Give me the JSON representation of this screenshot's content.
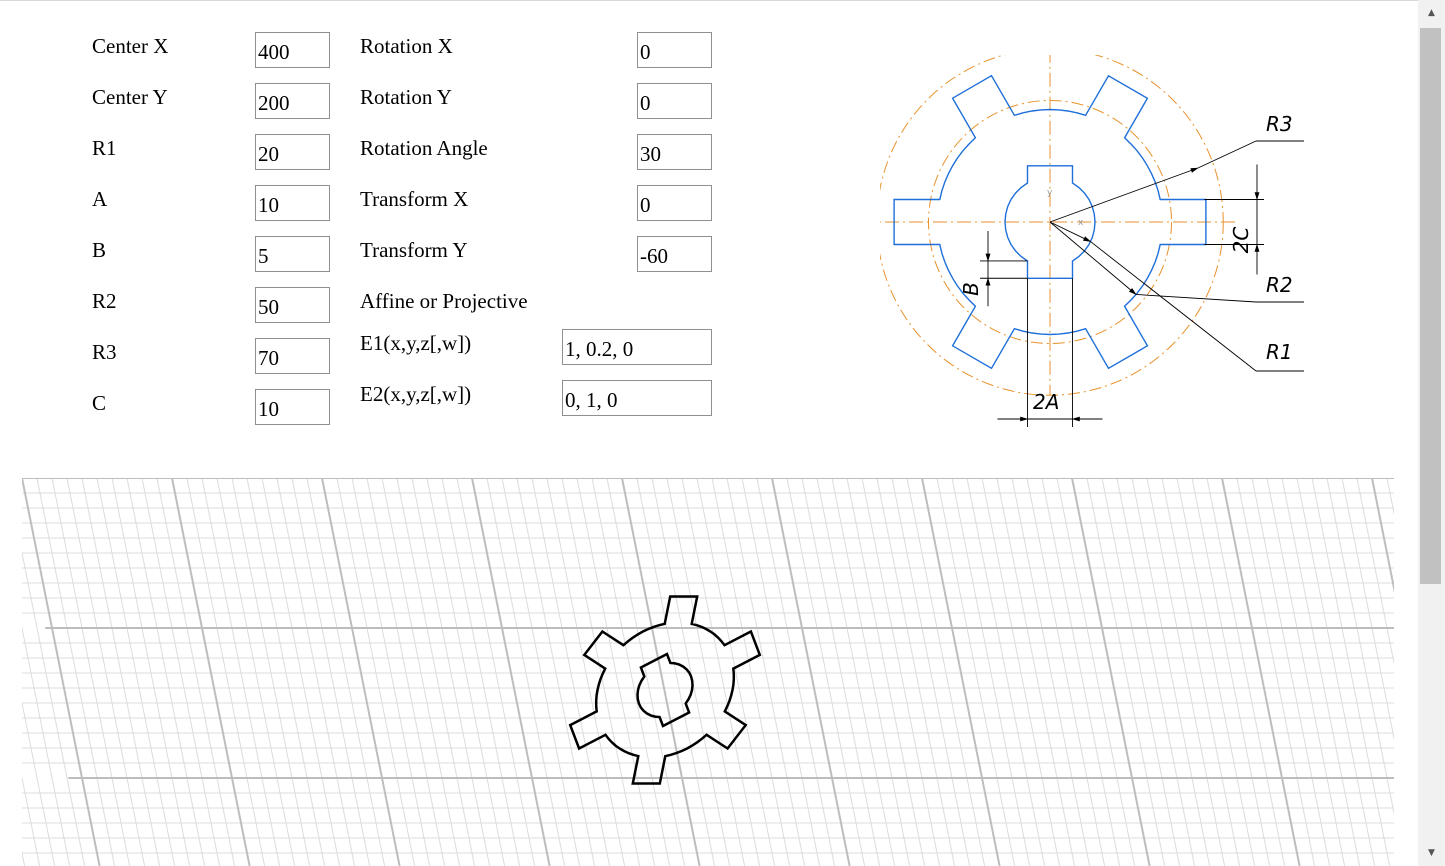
{
  "form": {
    "center_x": {
      "label": "Center X",
      "value": "400"
    },
    "center_y": {
      "label": "Center Y",
      "value": "200"
    },
    "r1": {
      "label": "R1",
      "value": "20"
    },
    "a": {
      "label": "A",
      "value": "10"
    },
    "b": {
      "label": "B",
      "value": "5"
    },
    "r2": {
      "label": "R2",
      "value": "50"
    },
    "r3": {
      "label": "R3",
      "value": "70"
    },
    "c": {
      "label": "C",
      "value": "10"
    },
    "rotation_x": {
      "label": "Rotation X",
      "value": "0"
    },
    "rotation_y": {
      "label": "Rotation Y",
      "value": "0"
    },
    "rotation_angle": {
      "label": "Rotation Angle",
      "value": "30"
    },
    "transform_x": {
      "label": "Transform X",
      "value": "0"
    },
    "transform_y": {
      "label": "Transform Y",
      "value": "-60"
    },
    "affine_label": "Affine or Projective",
    "e1": {
      "label": "E1(x,y,z[,w])",
      "value": "1, 0.2, 0"
    },
    "e2": {
      "label": "E2(x,y,z[,w])",
      "value": "0, 1, 0"
    }
  },
  "diagram": {
    "labels": {
      "r3": "R3",
      "r2": "R2",
      "r1": "R1",
      "two_c": "2C",
      "b": "B",
      "two_a": "2A",
      "y_axis": "y",
      "x_axis": "x"
    },
    "colors": {
      "contour": "#1e6fd9",
      "centerline": "#e8922c",
      "dimension": "#000000"
    }
  },
  "canvas": {
    "colors": {
      "grid_major": "#bdbdbd",
      "grid_minor": "#dcdcdc",
      "shape": "#000000"
    }
  },
  "icons": {
    "scroll_up": "triangle-up",
    "scroll_down": "triangle-down"
  }
}
